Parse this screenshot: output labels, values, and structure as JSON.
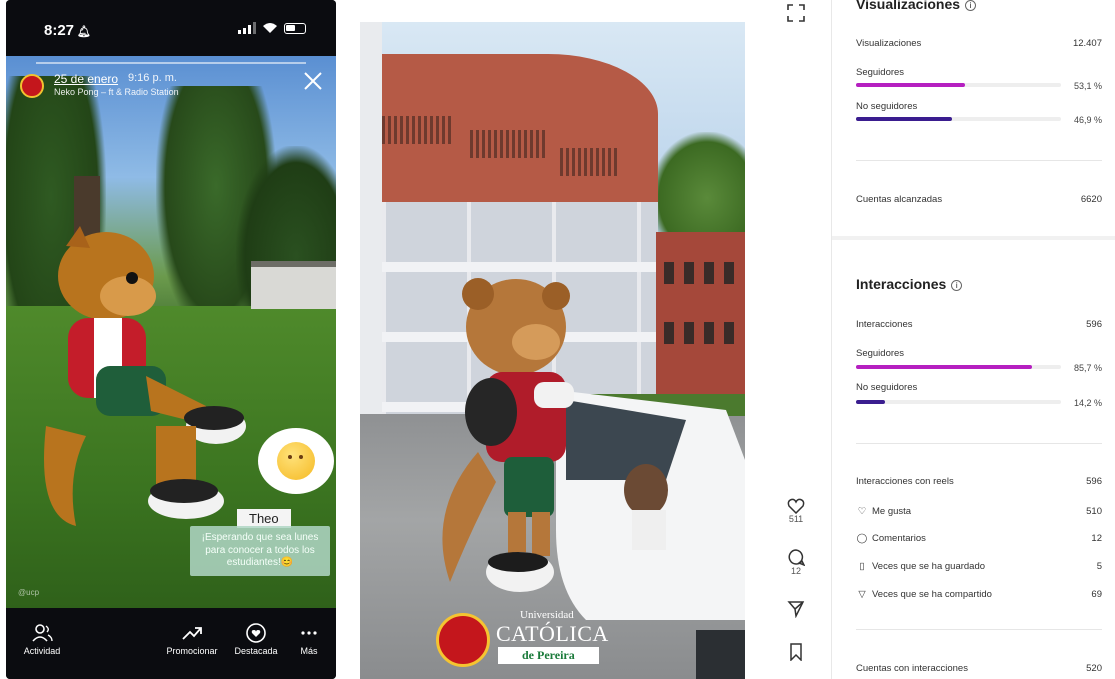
{
  "phone": {
    "status_time": "8:27",
    "story": {
      "date": "25 de enero",
      "time": "9:16 p. m.",
      "music": "Neko Pong – ft & Radio Station",
      "sticker_name": "Theo",
      "caption": "¡Esperando que sea lunes para conocer a todos los estudiantes!",
      "caption_emoji": "😊",
      "tag": "@ucp"
    },
    "tabbar": [
      {
        "label": "Actividad",
        "icon": "people-icon"
      },
      {
        "label": "Promocionar",
        "icon": "trend-icon"
      },
      {
        "label": "Destacada",
        "icon": "heart-circle-icon"
      },
      {
        "label": "Más",
        "icon": "more-icon"
      }
    ]
  },
  "reel_logo": {
    "line1": "Universidad",
    "line2": "CATÓLICA",
    "line3": "de Pereira"
  },
  "rail": {
    "likes": "511",
    "comments": "12"
  },
  "insights": {
    "visualizaciones": {
      "title": "Visualizaciones",
      "total_label": "Visualizaciones",
      "total_value": "12.407",
      "seguidores_label": "Seguidores",
      "seguidores_pct": "53,1 %",
      "seguidores_fill": 0.531,
      "no_seguidores_label": "No seguidores",
      "no_seguidores_pct": "46,9 %",
      "no_seguidores_fill": 0.469,
      "cuentas_label": "Cuentas alcanzadas",
      "cuentas_value": "6620"
    },
    "interacciones": {
      "title": "Interacciones",
      "total_label": "Interacciones",
      "total_value": "596",
      "seguidores_label": "Seguidores",
      "seguidores_pct": "85,7 %",
      "seguidores_fill": 0.857,
      "no_seguidores_label": "No seguidores",
      "no_seguidores_pct": "14,2 %",
      "no_seguidores_fill": 0.142,
      "reels_label": "Interacciones con reels",
      "reels_value": "596",
      "likes_label": "Me gusta",
      "likes_value": "510",
      "comments_label": "Comentarios",
      "comments_value": "12",
      "saved_label": "Veces que se ha guardado",
      "saved_value": "5",
      "shared_label": "Veces que se ha compartido",
      "shared_value": "69",
      "accounts_label": "Cuentas con interacciones",
      "accounts_value": "520"
    },
    "colors": {
      "seguidores": "#b51fc0",
      "no_seguidores": "#3a1d8f"
    }
  }
}
